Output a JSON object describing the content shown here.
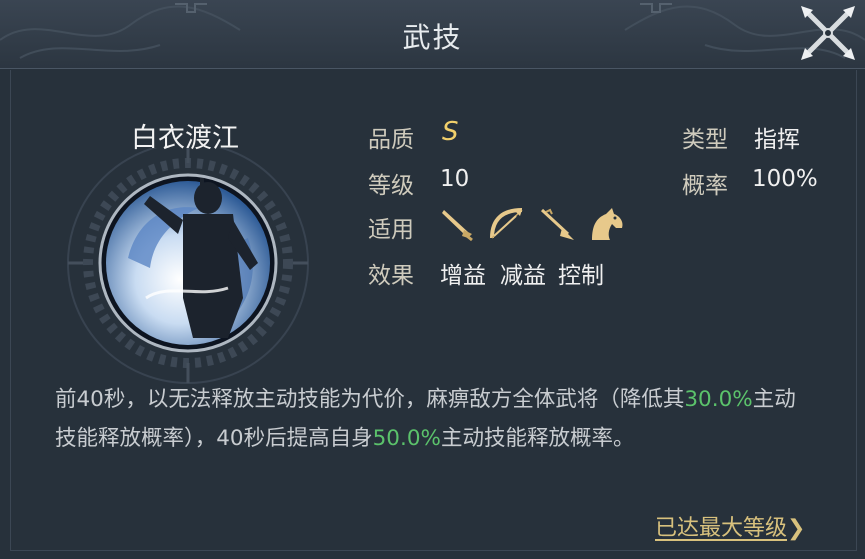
{
  "window": {
    "title": "武技",
    "close_icon": "crossed-swords-close-icon"
  },
  "skill": {
    "name": "白衣渡江",
    "portrait_icon": "armored-commander-portrait",
    "quality_label": "品质",
    "quality_value": "S",
    "level_label": "等级",
    "level_value": "10",
    "applies_label": "适用",
    "applies_icons": [
      "sword-icon",
      "bow-icon",
      "spear-icon",
      "horse-icon"
    ],
    "effect_label": "效果",
    "effects": [
      "增益",
      "减益",
      "控制"
    ],
    "type_label": "类型",
    "type_value": "指挥",
    "chance_label": "概率",
    "chance_value": "100%"
  },
  "description": {
    "part1": "前40秒，以无法释放主动技能为代价，麻痹敌方全体武将（降低其",
    "hl1": "30.0%",
    "part2": "主动技能释放概率），40秒后提高自身",
    "hl2": "50.0%",
    "part3": "主动技能释放概率。"
  },
  "footer": {
    "max_level_text": "已达最大等级",
    "arrow": "❯"
  },
  "colors": {
    "highlight": "#5bc26b",
    "gold": "#d8c17d",
    "quality": "#f2d06b"
  }
}
